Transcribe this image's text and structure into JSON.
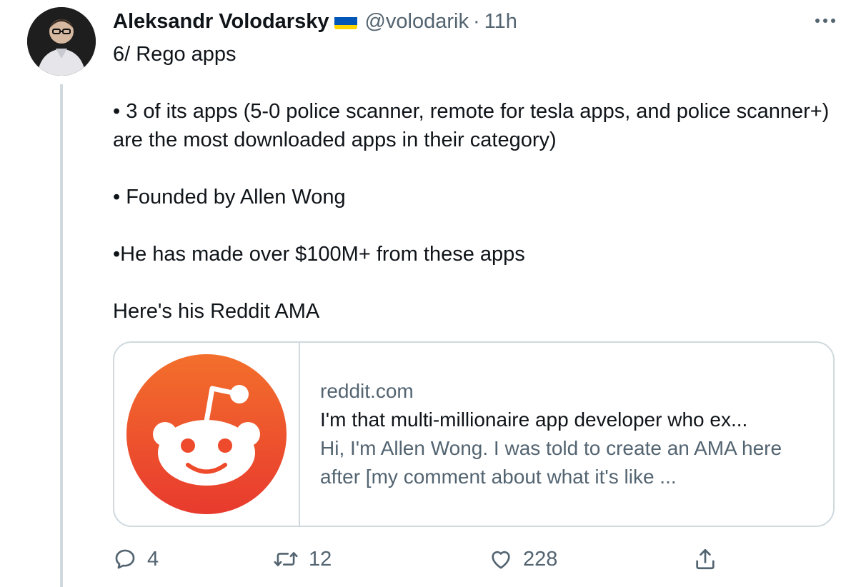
{
  "tweet": {
    "author_name": "Aleksandr Volodarsky",
    "flag_icon": "ukraine-flag-icon",
    "handle": "@volodarik",
    "separator": "·",
    "time": "11h",
    "more_icon": "more-horizontal-icon",
    "body": [
      "6/ Rego apps",
      "",
      "• 3 of its apps (5-0 police scanner, remote for tesla apps, and police scanner+) are the most downloaded apps in their category)",
      "",
      "• Founded by Allen Wong",
      "",
      "•He has made over $100M+ from these apps",
      "",
      "Here's his Reddit AMA"
    ]
  },
  "link_card": {
    "image_icon": "reddit-logo",
    "domain": "reddit.com",
    "title": "I'm that multi-millionaire app developer who ex...",
    "description": "Hi, I'm Allen Wong. I was told to create an AMA here after [my comment about what it's like ..."
  },
  "actions": {
    "reply": {
      "icon": "reply-icon",
      "count": "4"
    },
    "retweet": {
      "icon": "retweet-icon",
      "count": "12"
    },
    "like": {
      "icon": "like-heart-icon",
      "count": "228"
    },
    "share": {
      "icon": "share-icon",
      "count": ""
    }
  },
  "colors": {
    "text": "#0f1419",
    "secondary": "#536471",
    "border": "#cfd9de",
    "reddit_orange": "#ff4500",
    "flag_blue": "#0057b7",
    "flag_yellow": "#ffd700"
  }
}
